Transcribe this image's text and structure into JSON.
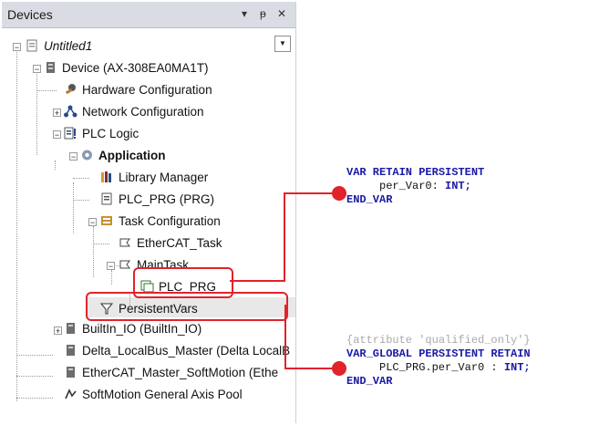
{
  "panel": {
    "title": "Devices",
    "controls": {
      "dropdown": "▾",
      "pin": "ᵽ",
      "close": "✕"
    }
  },
  "tree": {
    "project": "Untitled1",
    "device": "Device (AX-308EA0MA1T)",
    "hardware": "Hardware Configuration",
    "network": "Network Configuration",
    "plc_logic": "PLC Logic",
    "application": "Application",
    "library": "Library Manager",
    "plc_prg": "PLC_PRG (PRG)",
    "task_config": "Task Configuration",
    "ethercat_task": "EtherCAT_Task",
    "main_task": "MainTask",
    "main_task_prg": "PLC_PRG",
    "persistent": "PersistentVars",
    "builtin": "BuiltIn_IO (BuiltIn_IO)",
    "delta": "Delta_LocalBus_Master (Delta LocalB",
    "ethercat_master": "EtherCAT_Master_SoftMotion (Ethe",
    "softmotion": "SoftMotion General Axis Pool"
  },
  "code_top": {
    "line1": "VAR RETAIN PERSISTENT",
    "line2_var": "per_Var0:",
    "line2_type": "INT;",
    "line3": "END_VAR"
  },
  "code_bottom": {
    "line0": "{attribute 'qualified_only'}",
    "line1": "VAR_GLOBAL PERSISTENT RETAIN",
    "line2_var": "PLC_PRG.per_Var0 :",
    "line2_type": "INT;",
    "line3": "END_VAR"
  },
  "colors": {
    "highlight": "#e0242a",
    "keyword": "#1a1aa6",
    "attribute": "#a9a9a9"
  }
}
